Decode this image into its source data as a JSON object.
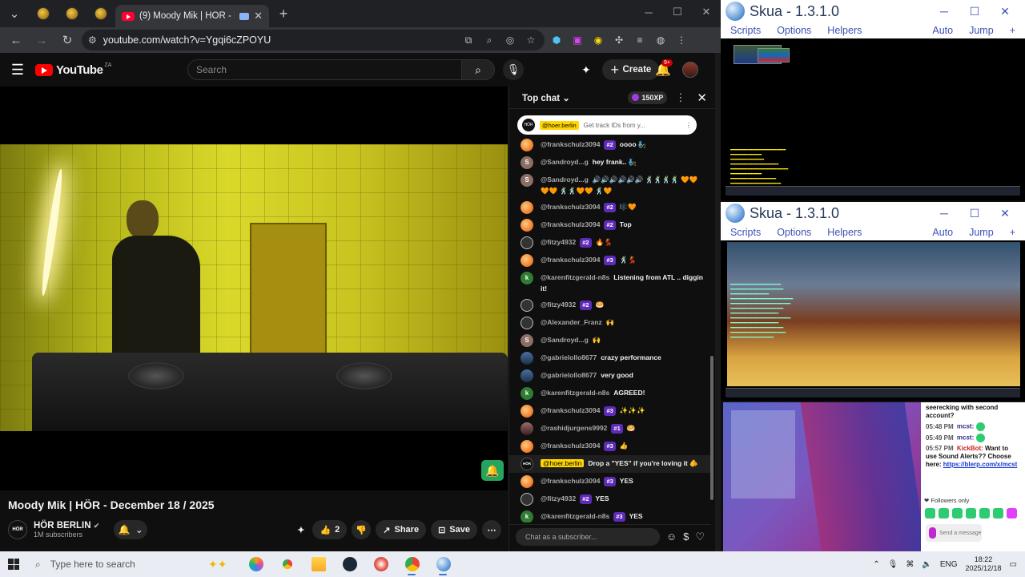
{
  "browser": {
    "active_tab_title": "(9) Moody Mik | HÖR - Dec",
    "url": "youtube.com/watch?v=Ygqi6cZPOYU"
  },
  "youtube": {
    "logo_text": "YouTube",
    "country": "ZA",
    "search_placeholder": "Search",
    "create_label": "Create",
    "notification_count": "9+",
    "video_title": "Moody Mik | HÖR - December 18 / 2025",
    "channel": {
      "avatar_text": "HÖR",
      "name": "HÖR BERLIN",
      "subscribers": "1M subscribers"
    },
    "actions": {
      "like_count": "2",
      "share_label": "Share",
      "save_label": "Save"
    }
  },
  "chat": {
    "mode": "Top chat",
    "xp": "150XP",
    "pinned": {
      "author": "@hoer.berlin",
      "text": "Get track IDs from y..."
    },
    "input_placeholder": "Chat as a subscriber...",
    "messages": [
      {
        "avatar": "sun",
        "initial": "",
        "author": "@frankschulz3094",
        "badge": "#2",
        "text": "oooo 🧞"
      },
      {
        "avatar": "s",
        "initial": "S",
        "author": "@Sandroyd...g",
        "badge": "",
        "text": "hey frank.. 🧞"
      },
      {
        "avatar": "s",
        "initial": "S",
        "author": "@Sandroyd...g",
        "badge": "",
        "text": "🔊🔊🔊🔊🔊🔊 🕺🕺🕺🕺 🧡🧡🧡🧡 🕺🕺🧡🧡 🕺🧡"
      },
      {
        "avatar": "sun",
        "initial": "",
        "author": "@frankschulz3094",
        "badge": "#2",
        "text": "🎼🧡"
      },
      {
        "avatar": "sun",
        "initial": "",
        "author": "@frankschulz3094",
        "badge": "#2",
        "text": "Top"
      },
      {
        "avatar": "bw",
        "initial": "",
        "author": "@fitzy4932",
        "badge": "#2",
        "text": "🔥💃"
      },
      {
        "avatar": "sun",
        "initial": "",
        "author": "@frankschulz3094",
        "badge": "#3",
        "text": "🕺💃"
      },
      {
        "avatar": "k",
        "initial": "k",
        "author": "@karenfitzgerald-n8s",
        "badge": "",
        "text": "Listening from ATL .. diggin it!"
      },
      {
        "avatar": "bw",
        "initial": "",
        "author": "@fitzy4932",
        "badge": "#2",
        "text": "🥯"
      },
      {
        "avatar": "bw",
        "initial": "",
        "author": "@Alexander_Franz",
        "badge": "",
        "text": "🙌"
      },
      {
        "avatar": "s",
        "initial": "S",
        "author": "@Sandroyd...g",
        "badge": "",
        "text": "🙌"
      },
      {
        "avatar": "g",
        "initial": "",
        "author": "@gabrielollo8677",
        "badge": "",
        "text": "crazy performance"
      },
      {
        "avatar": "g",
        "initial": "",
        "author": "@gabrielollo8677",
        "badge": "",
        "text": "very good"
      },
      {
        "avatar": "k",
        "initial": "k",
        "author": "@karenfitzgerald-n8s",
        "badge": "",
        "text": "AGREED!"
      },
      {
        "avatar": "sun",
        "initial": "",
        "author": "@frankschulz3094",
        "badge": "#3",
        "text": "✨✨✨"
      },
      {
        "avatar": "r",
        "initial": "",
        "author": "@rashidjurgens9992",
        "badge": "#1",
        "text": "🥯"
      },
      {
        "avatar": "sun",
        "initial": "",
        "author": "@frankschulz3094",
        "badge": "#3",
        "text": "👍"
      },
      {
        "avatar": "hor",
        "initial": "HÖR",
        "author": "@hoer.berlin",
        "badge": "",
        "text": "Drop a \"YES\" if you're loving it 🫵",
        "owner": true
      },
      {
        "avatar": "sun",
        "initial": "",
        "author": "@frankschulz3094",
        "badge": "#3",
        "text": "YES"
      },
      {
        "avatar": "bw",
        "initial": "",
        "author": "@fitzy4932",
        "badge": "#2",
        "text": "YES"
      },
      {
        "avatar": "k",
        "initial": "k",
        "author": "@karenfitzgerald-n8s",
        "badge": "#3",
        "text": "YES"
      }
    ]
  },
  "skua1": {
    "title": "Skua - 1.3.1.0",
    "menu": [
      "Scripts",
      "Options",
      "Helpers"
    ],
    "auto": "Auto",
    "jump": "Jump"
  },
  "skua2": {
    "title": "Skua - 1.3.1.0",
    "menu": [
      "Scripts",
      "Options",
      "Helpers"
    ],
    "auto": "Auto",
    "jump": "Jump"
  },
  "side_chat": {
    "top_text": "seerecking with second account?",
    "lines": [
      {
        "time": "05:48 PM",
        "name": "mcst:"
      },
      {
        "time": "05:49 PM",
        "name": "mcst:"
      }
    ],
    "bot_time": "05:57 PM",
    "bot_name": "KickBot:",
    "bot_text": "Want to use Sound Alerts?? Choose here:",
    "bot_link": "https://blerp.com/x/mcst",
    "followers": "Followers only",
    "send": "Send a message"
  },
  "taskbar": {
    "search_placeholder": "Type here to search",
    "lang": "ENG",
    "time": "18:22",
    "date": "2025/12/18"
  }
}
